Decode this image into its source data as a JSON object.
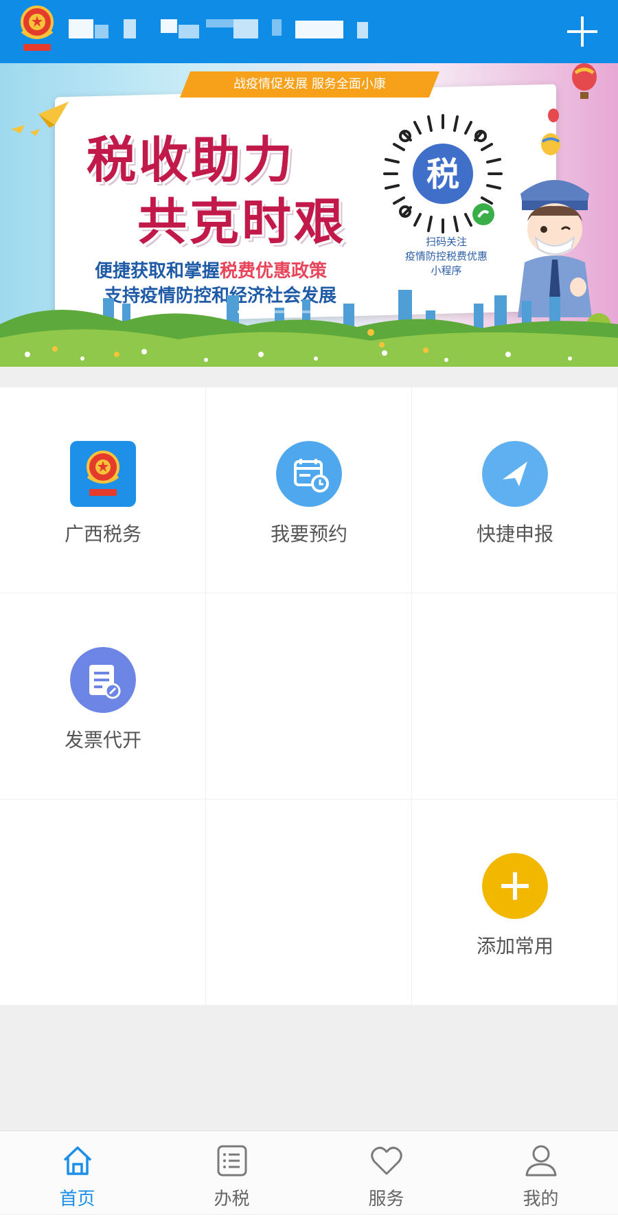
{
  "header": {
    "title": "██ ███ ██ ████ ██ █",
    "add_icon": "plus-icon",
    "logo_icon": "tax-emblem-icon"
  },
  "banner": {
    "ribbon_text": "战疫情促发展 服务全面小康",
    "headline_line1": "税收助力",
    "headline_line2": "共克时艰",
    "subline1_prefix": "便捷获取和掌握",
    "subline1_highlight": "税费优惠政策",
    "subline2": "支持疫情防控和经济社会发展",
    "qr_center_char": "税",
    "qr_caption_line1": "扫码关注",
    "qr_caption_line2": "疫情防控税费优惠",
    "qr_caption_line3": "小程序"
  },
  "grid": {
    "items": [
      {
        "label": "广西税务",
        "icon": "tax-emblem-icon",
        "color": "#1e90e8"
      },
      {
        "label": "我要预约",
        "icon": "calendar-clock-icon",
        "color": "#4fa8ee"
      },
      {
        "label": "快捷申报",
        "icon": "paper-plane-icon",
        "color": "#5eb0f0"
      },
      {
        "label": "发票代开",
        "icon": "invoice-edit-icon",
        "color": "#6d86e6"
      },
      {
        "label": "添加常用",
        "icon": "plus-circle-icon",
        "color": "#f2b800"
      }
    ]
  },
  "bottom_nav": {
    "items": [
      {
        "label": "首页",
        "icon": "home-icon",
        "active": true
      },
      {
        "label": "办税",
        "icon": "list-icon",
        "active": false
      },
      {
        "label": "服务",
        "icon": "heart-icon",
        "active": false
      },
      {
        "label": "我的",
        "icon": "user-icon",
        "active": false
      }
    ]
  },
  "colors": {
    "header_bg": "#0f8de6",
    "active_tab": "#1a8ee8",
    "inactive_tab": "#666666"
  }
}
